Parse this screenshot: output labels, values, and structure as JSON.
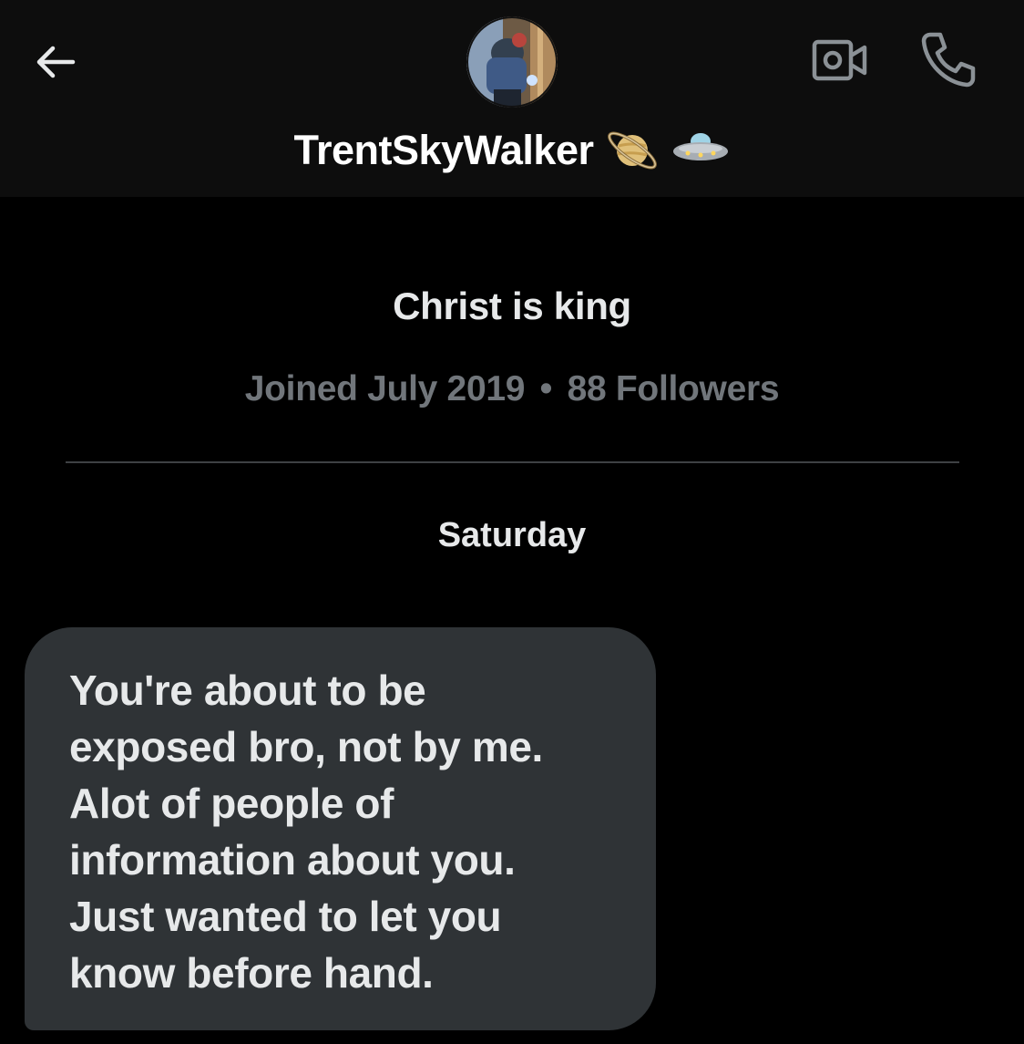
{
  "header": {
    "display_name": "TrentSkyWalker",
    "name_emojis": [
      "saturn-emoji",
      "ufo-emoji"
    ],
    "back_icon": "arrow-left-icon",
    "video_icon": "video-camera-icon",
    "call_icon": "phone-icon"
  },
  "profile": {
    "bio": "Christ is king",
    "joined": "Joined July 2019",
    "separator": "•",
    "followers": "88 Followers"
  },
  "conversation": {
    "day_label": "Saturday",
    "messages": [
      {
        "direction": "received",
        "text": "You're about to be\nexposed bro, not by me.\nAlot of people of\ninformation about you.\nJust wanted to let you\nknow before hand."
      }
    ]
  },
  "colors": {
    "background": "#000000",
    "header_background": "#0d0d0d",
    "bubble_background": "#2f3336",
    "primary_text": "#e7e9ea",
    "secondary_text": "#71767b",
    "icon_color": "#8b9196"
  }
}
